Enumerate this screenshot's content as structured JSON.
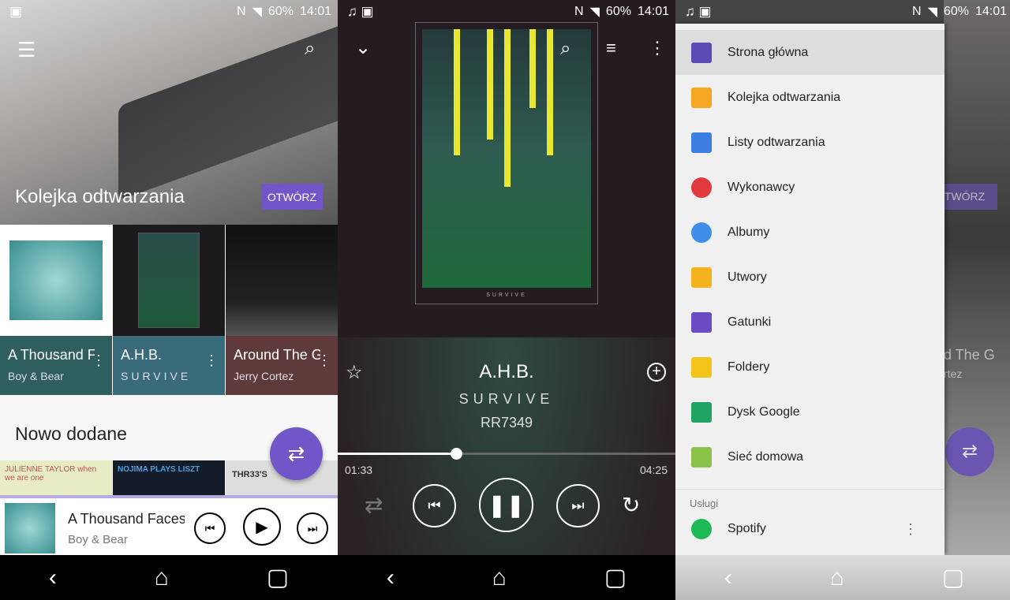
{
  "status": {
    "battery": "60%",
    "time": "14:01"
  },
  "left": {
    "hero_title": "Kolejka odtwarzania",
    "hero_button": "OTWÓRZ",
    "tiles": [
      {
        "title": "A Thousand Faces",
        "subtitle": "Boy & Bear",
        "color": "#2e5f5e",
        "playing": true
      },
      {
        "title": "A.H.B.",
        "subtitle": "SURVIVE",
        "color": "#3a6b7a"
      },
      {
        "title": "Around The Ground",
        "subtitle": "Jerry Cortez",
        "color": "#5e3b3a"
      }
    ],
    "section_title": "Nowo dodane",
    "recent": [
      "JULIENNE TAYLOR when we are one",
      "NOJIMA PLAYS LISZT",
      "THR33'S"
    ],
    "mini_player": {
      "title": "A Thousand Faces",
      "artist": "Boy & Bear"
    }
  },
  "middle": {
    "title": "A.H.B.",
    "artist": "SURVIVE",
    "album": "RR7349",
    "art_caption": "SURVIVE",
    "elapsed": "01:33",
    "duration": "04:25",
    "progress": 0.35
  },
  "right": {
    "items": [
      {
        "label": "Strona główna",
        "color": "#5c4bb5",
        "selected": true
      },
      {
        "label": "Kolejka odtwarzania",
        "color": "#f5a623"
      },
      {
        "label": "Listy odtwarzania",
        "color": "#3b7de0"
      },
      {
        "label": "Wykonawcy",
        "color": "#e0393e"
      },
      {
        "label": "Albumy",
        "color": "#3f8ee8"
      },
      {
        "label": "Utwory",
        "color": "#f5b21e"
      },
      {
        "label": "Gatunki",
        "color": "#6a4bc4"
      },
      {
        "label": "Foldery",
        "color": "#f2c318"
      },
      {
        "label": "Dysk Google",
        "color": "#1fa463"
      },
      {
        "label": "Sieć domowa",
        "color": "#8bc34a"
      }
    ],
    "services_header": "Usługi",
    "service": {
      "label": "Spotify",
      "color": "#1db954"
    },
    "background_button": "OTWÓRZ",
    "background_tile_text": "d The G",
    "background_tile_sub": "rtez"
  },
  "accent": "#7255c8"
}
